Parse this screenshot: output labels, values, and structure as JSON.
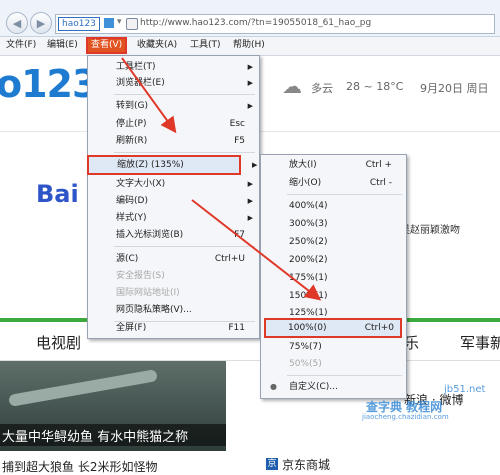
{
  "toolbar": {
    "back_icon": "back-arrow-icon",
    "forward_icon": "forward-arrow-icon",
    "site_label": "hao123",
    "url": "http://www.hao123.com/?tn=19055018_61_hao_pg"
  },
  "menubar": {
    "items": [
      "文件(F)",
      "编辑(E)",
      "查看(V)",
      "收藏夹(A)",
      "工具(T)",
      "帮助(H)"
    ]
  },
  "page": {
    "logo": "o123",
    "weather": "多云",
    "temp": "28 ~ 18°C",
    "date": "9月20日 周日",
    "baidu": "Bai",
    "hotnews": "吴赵丽颖激吻",
    "nav": [
      "电视剧",
      "乐",
      "军事新"
    ],
    "news1": "大量中华鲟幼鱼 有水中熊猫之称",
    "news2": "捕到超大狼鱼 长2米形如怪物",
    "sina": "新浪 · 微博",
    "jd": "京东商城"
  },
  "view_menu": {
    "items": [
      {
        "label": "工具栏(T)",
        "shortcut": "",
        "submenu": true
      },
      {
        "label": "浏览器栏(E)",
        "shortcut": "",
        "submenu": true
      },
      {
        "label": "转到(G)",
        "shortcut": "",
        "submenu": true
      },
      {
        "label": "停止(P)",
        "shortcut": "Esc",
        "submenu": false
      },
      {
        "label": "刷新(R)",
        "shortcut": "F5",
        "submenu": false
      },
      {
        "label": "缩放(Z) (135%)",
        "shortcut": "",
        "submenu": true
      },
      {
        "label": "文字大小(X)",
        "shortcut": "",
        "submenu": true
      },
      {
        "label": "编码(D)",
        "shortcut": "",
        "submenu": true
      },
      {
        "label": "样式(Y)",
        "shortcut": "",
        "submenu": true
      },
      {
        "label": "插入光标浏览(B)",
        "shortcut": "F7",
        "submenu": false
      },
      {
        "label": "源(C)",
        "shortcut": "Ctrl+U",
        "submenu": false
      },
      {
        "label": "安全报告(S)",
        "shortcut": "",
        "submenu": false
      },
      {
        "label": "国际网站地址(I)",
        "shortcut": "",
        "submenu": false
      },
      {
        "label": "网页隐私策略(V)...",
        "shortcut": "",
        "submenu": false
      },
      {
        "label": "全屏(F)",
        "shortcut": "F11",
        "submenu": false
      }
    ]
  },
  "zoom_menu": {
    "items": [
      {
        "label": "放大(I)",
        "shortcut": "Ctrl +"
      },
      {
        "label": "缩小(O)",
        "shortcut": "Ctrl -"
      },
      {
        "label": "400%(4)",
        "shortcut": ""
      },
      {
        "label": "300%(3)",
        "shortcut": ""
      },
      {
        "label": "250%(2)",
        "shortcut": ""
      },
      {
        "label": "200%(2)",
        "shortcut": ""
      },
      {
        "label": "175%(1)",
        "shortcut": ""
      },
      {
        "label": "150%(1)",
        "shortcut": ""
      },
      {
        "label": "125%(1)",
        "shortcut": ""
      },
      {
        "label": "100%(0)",
        "shortcut": "Ctrl+0"
      },
      {
        "label": "75%(7)",
        "shortcut": ""
      },
      {
        "label": "50%(5)",
        "shortcut": ""
      },
      {
        "label": "自定义(C)...",
        "shortcut": ""
      }
    ]
  },
  "watermark": {
    "line1": "查字典 教程网",
    "line2": "jiaocheng.chazidian.com",
    "site": "jb51.net"
  },
  "colors": {
    "highlight": "#e03828",
    "arrow": "#e03828",
    "accent": "#1e7bd0"
  }
}
